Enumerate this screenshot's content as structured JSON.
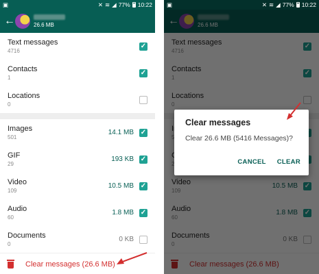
{
  "status": {
    "percent": "77%",
    "time": "10:22"
  },
  "header": {
    "size": "26.6 MB"
  },
  "items": [
    {
      "label": "Text messages",
      "count": "4716",
      "size": "",
      "checked": true
    },
    {
      "label": "Contacts",
      "count": "1",
      "size": "",
      "checked": true
    },
    {
      "label": "Locations",
      "count": "0",
      "size": "",
      "checked": false
    },
    {
      "label": "Images",
      "count": "501",
      "size": "14.1 MB",
      "checked": true
    },
    {
      "label": "GIF",
      "count": "29",
      "size": "193 KB",
      "checked": true
    },
    {
      "label": "Video",
      "count": "109",
      "size": "10.5 MB",
      "checked": true
    },
    {
      "label": "Audio",
      "count": "60",
      "size": "1.8 MB",
      "checked": true
    },
    {
      "label": "Documents",
      "count": "0",
      "size": "0 KB",
      "checked": false
    }
  ],
  "clear_label": "Clear messages (26.6 MB)",
  "dialog": {
    "title": "Clear messages",
    "message": "Clear 26.6 MB (5416 Messages)?",
    "cancel": "CANCEL",
    "clear": "CLEAR"
  },
  "colors": {
    "primary": "#075e54",
    "accent": "#1fa294",
    "danger": "#d32f2f"
  }
}
